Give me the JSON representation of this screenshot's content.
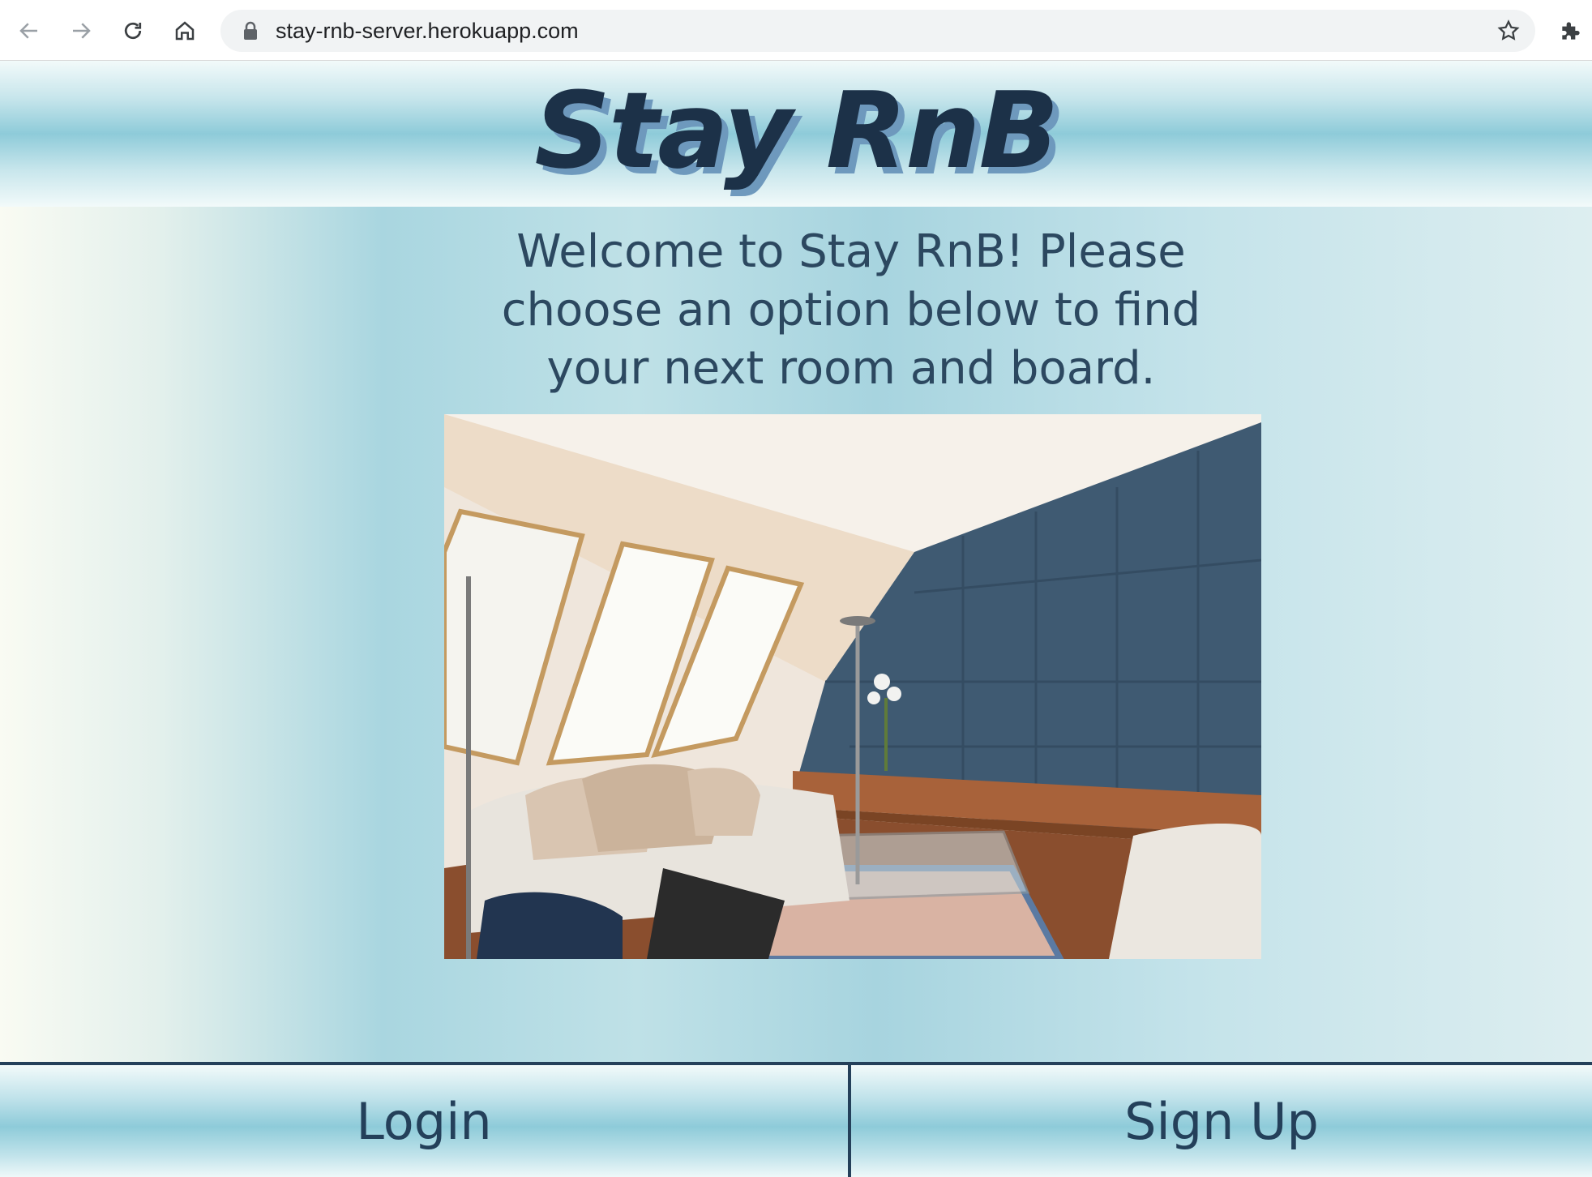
{
  "browser": {
    "url": "stay-rnb-server.herokuapp.com",
    "icons": [
      "back-arrow-icon",
      "forward-arrow-icon",
      "reload-icon",
      "home-icon",
      "lock-icon",
      "star-icon",
      "puzzle-icon"
    ]
  },
  "header": {
    "logo": "Stay RnB"
  },
  "main": {
    "welcome": "Welcome to Stay RnB! Please choose an option below to find your next room and board."
  },
  "footer": {
    "login_label": "Login",
    "signup_label": "Sign Up"
  },
  "colors": {
    "navy": "#1c3148",
    "logo_shadow": "#6e99bd",
    "text": "#2c4860",
    "band_light": "#f2fafa",
    "band_mid": "#8ecbd9"
  }
}
